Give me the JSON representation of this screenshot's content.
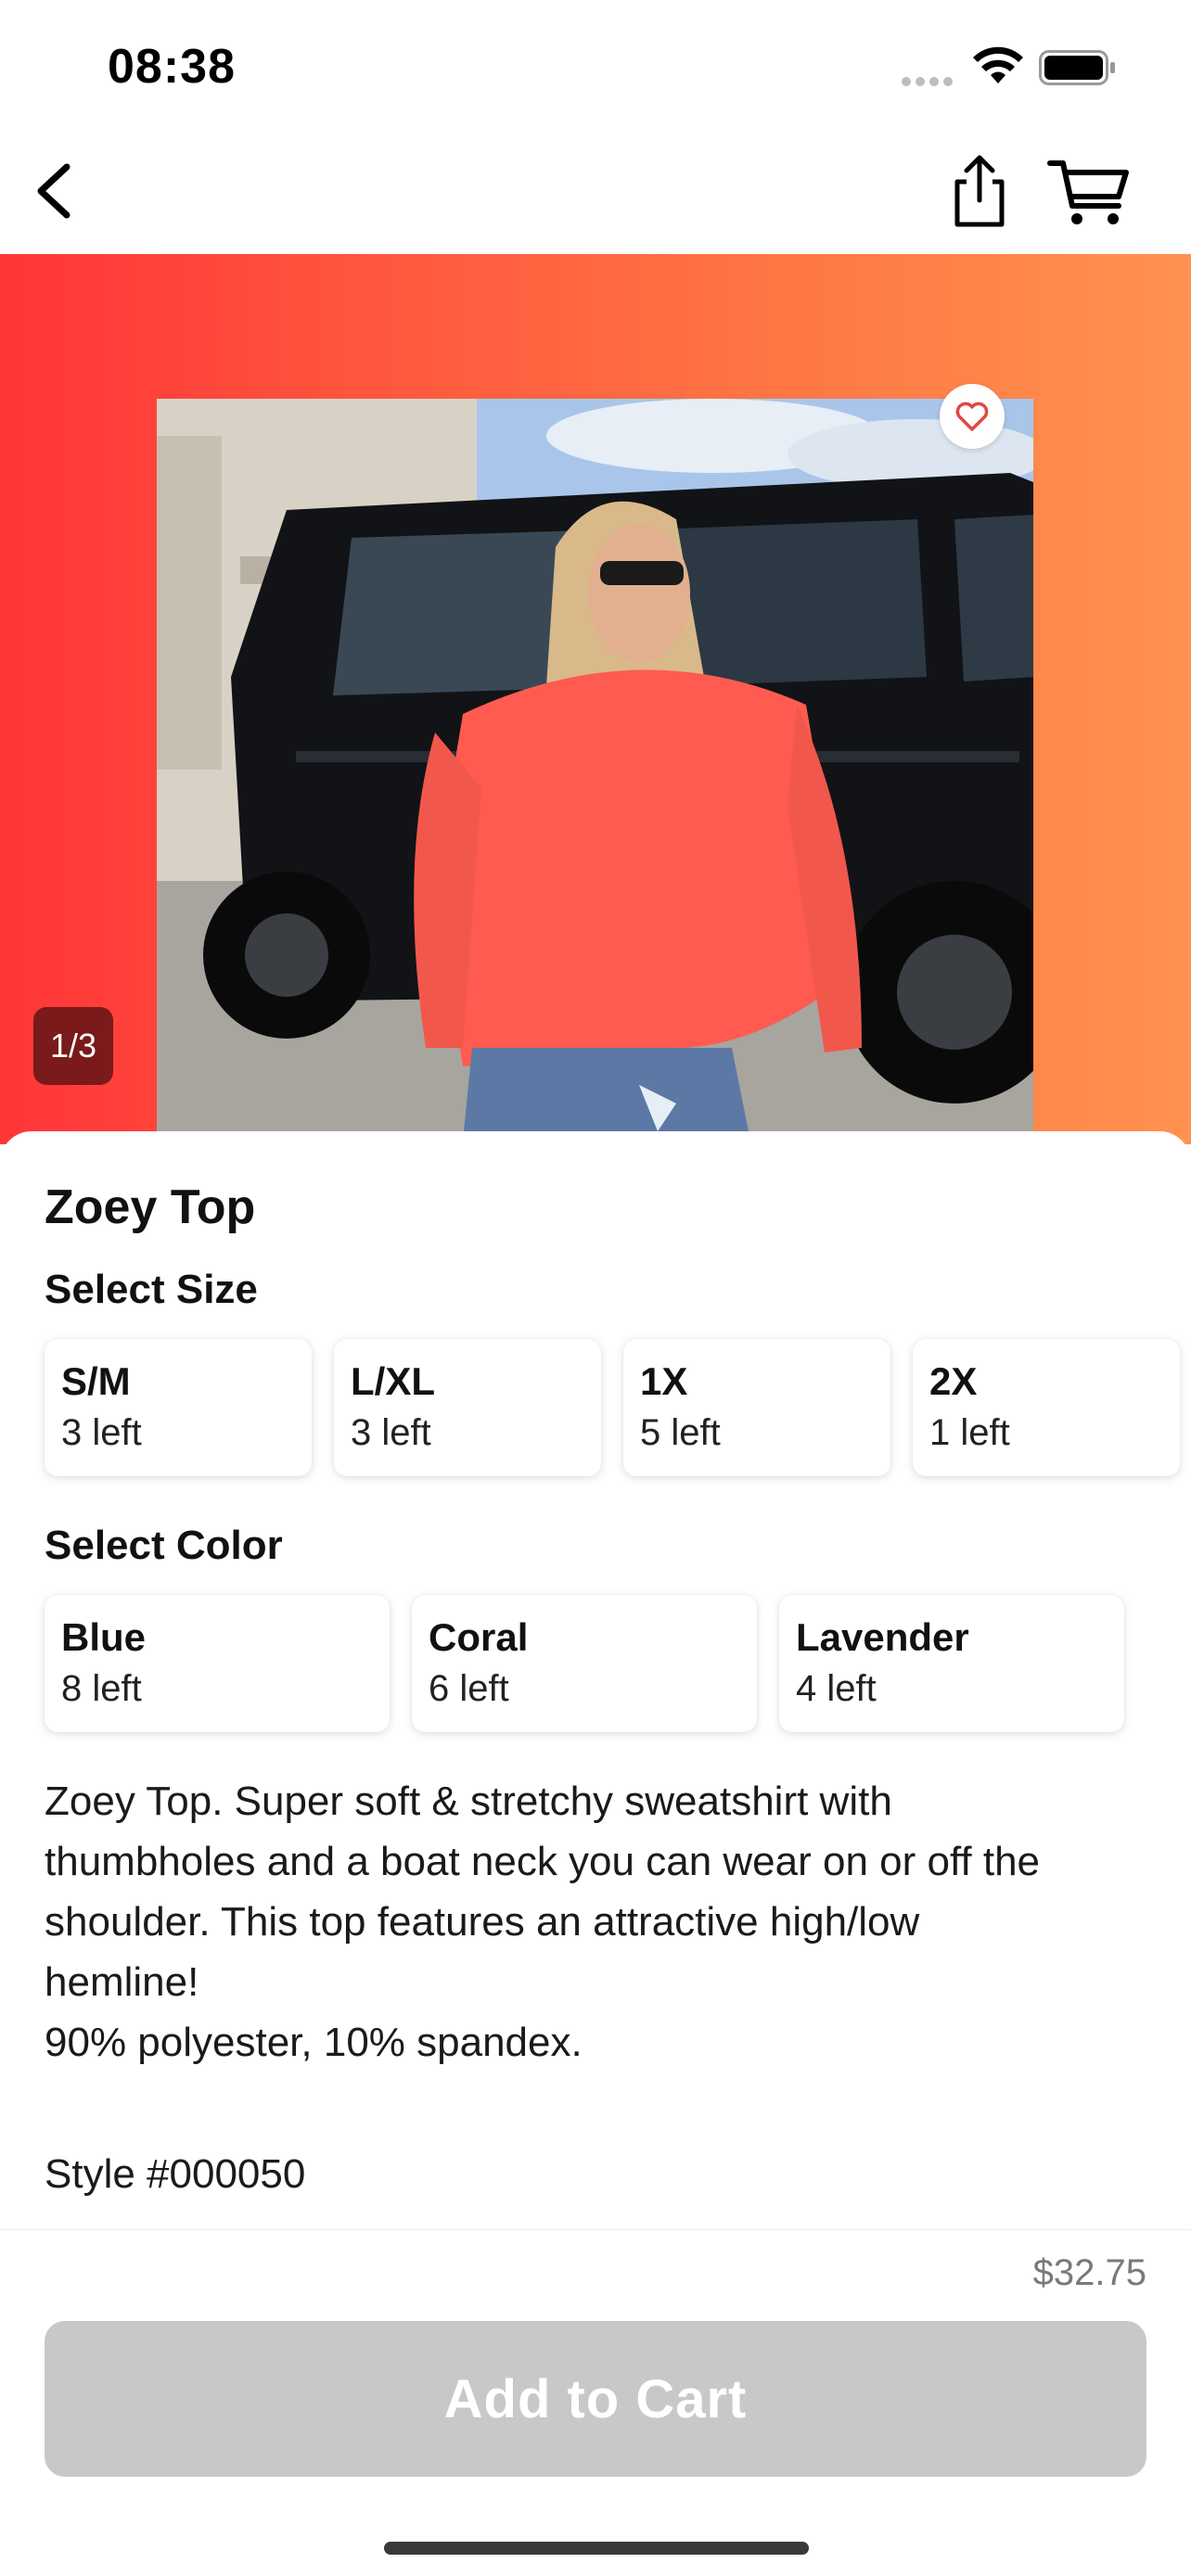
{
  "status_bar": {
    "time": "08:38"
  },
  "nav": {
    "icons": [
      "chevron-left-icon",
      "share-icon",
      "cart-icon"
    ]
  },
  "hero": {
    "gradient_colors": [
      "#ff3538",
      "#ff9250"
    ],
    "image_counter": "1/3",
    "favorite_icon": "heart-icon"
  },
  "product": {
    "title": "Zoey Top",
    "size_label": "Select Size",
    "sizes": [
      {
        "name": "S/M",
        "stock": "3 left"
      },
      {
        "name": "L/XL",
        "stock": "3 left"
      },
      {
        "name": "1X",
        "stock": "5 left"
      },
      {
        "name": "2X",
        "stock": "1 left"
      }
    ],
    "color_label": "Select Color",
    "colors": [
      {
        "name": "Blue",
        "stock": "8 left"
      },
      {
        "name": "Coral",
        "stock": "6 left"
      },
      {
        "name": "Lavender",
        "stock": "4 left"
      }
    ],
    "description": "Zoey Top. Super soft & stretchy sweatshirt with\nthumbholes and a boat neck you can wear on or off the\nshoulder. This top features an attractive high/low\nhemline!\n90% polyester, 10% spandex.",
    "style_number": "Style #000050"
  },
  "purchase": {
    "price": "$32.75",
    "add_to_cart_label": "Add to Cart",
    "button_color": "#c8c8c8"
  }
}
